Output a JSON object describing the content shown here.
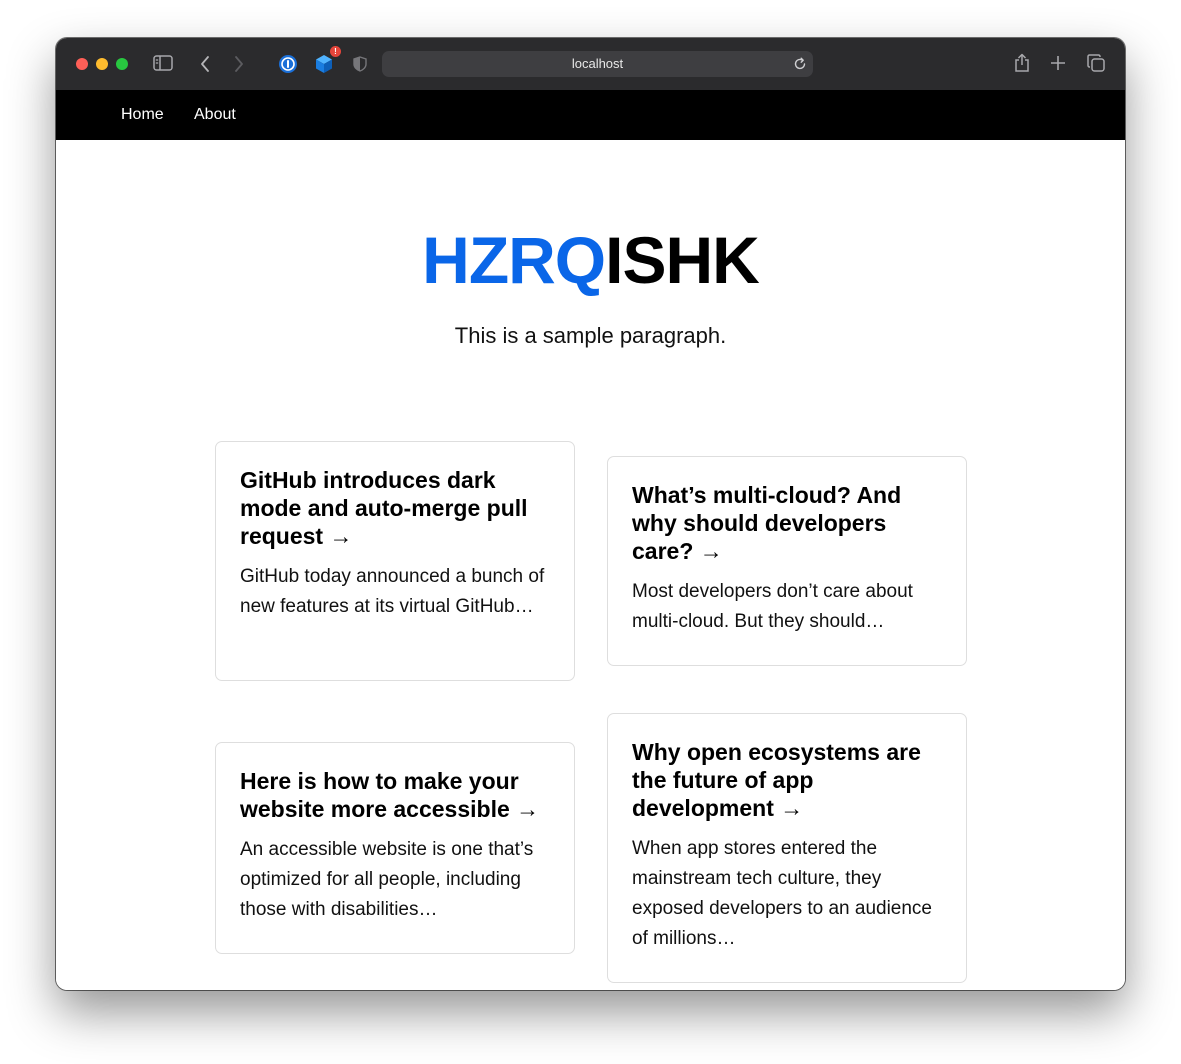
{
  "browser": {
    "url": "localhost",
    "extension_badge": "!"
  },
  "nav": {
    "items": [
      {
        "label": "Home"
      },
      {
        "label": "About"
      }
    ]
  },
  "hero": {
    "title_accent": "HZRQ",
    "title_rest": "ISHK",
    "subtitle": "This is a sample paragraph.",
    "accent_color": "#0a66e8"
  },
  "cards": [
    {
      "title": "GitHub introduces dark mode and auto-merge pull request →",
      "excerpt": "GitHub today announced a bunch of new features at its virtual GitHub…"
    },
    {
      "title": "What’s multi-cloud? And why should developers care? →",
      "excerpt": "Most developers don’t care about multi-cloud. But they should…"
    },
    {
      "title": "Here is how to make your website more accessible →",
      "excerpt": "An accessible website is one that’s optimized for all people, including those with disabilities…"
    },
    {
      "title": "Why open ecosystems are the future of app development →",
      "excerpt": "When app stores entered the mainstream tech culture, they exposed developers to an audience of millions…"
    }
  ]
}
